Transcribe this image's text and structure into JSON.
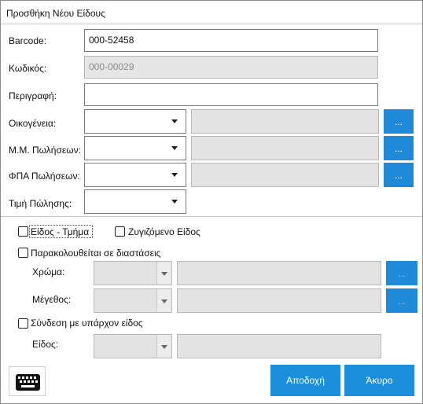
{
  "window": {
    "title": "Προσθήκη Νέου Είδους"
  },
  "fields": {
    "barcode": {
      "label": "Barcode:",
      "value": "000-52458"
    },
    "code": {
      "label": "Κωδικός:",
      "value": "000-00029"
    },
    "description": {
      "label": "Περιγραφή:",
      "value": ""
    },
    "family": {
      "label": "Οικογένεια:",
      "button": "..."
    },
    "unit": {
      "label": "Μ.Μ. Πωλήσεων:",
      "button": "..."
    },
    "vat": {
      "label": "ΦΠΑ Πωλήσεων:",
      "button": "..."
    },
    "price": {
      "label": "Τιμή Πώλησης:"
    }
  },
  "options": {
    "item_department": {
      "label": "Είδος - Τμήμα",
      "checked": false
    },
    "weighed_item": {
      "label": "Ζυγιζόμενο Είδος",
      "checked": false
    },
    "track_dimensions": {
      "label": "Παρακολουθείται σε διαστάσεις",
      "checked": false
    },
    "color": {
      "label": "Χρώμα:",
      "button": "..."
    },
    "size": {
      "label": "Μέγεθος:",
      "button": "..."
    },
    "link_existing": {
      "label": "Σύνδεση με υπάρχον είδος",
      "checked": false
    },
    "item": {
      "label": "Είδος:"
    }
  },
  "buttons": {
    "accept": "Αποδοχή",
    "cancel": "Άκυρο"
  },
  "icons": {
    "keyboard": "keyboard-icon",
    "dropdown": "chevron-down-icon"
  },
  "colors": {
    "accent": "#1b8fdb"
  }
}
